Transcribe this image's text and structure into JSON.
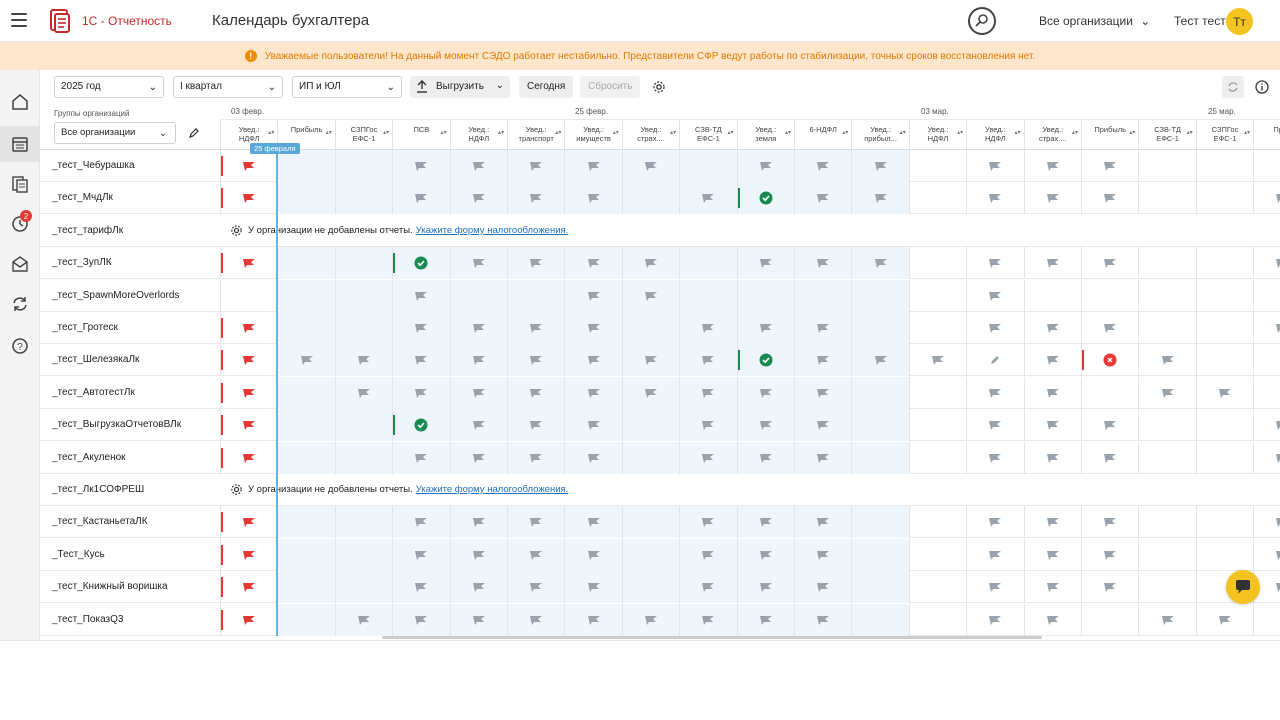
{
  "header": {
    "brand": "1С - Отчетность",
    "title": "Календарь бухгалтера",
    "org_select": "Все организации",
    "user_name": "Тест тест",
    "avatar_initials": "Тт"
  },
  "banner": {
    "text": "Уважаемые пользователи! На данный момент СЭДО работает нестабильно. Представители СФР ведут работы по стабилизации, точных сроков восстановления нет.",
    "color": "#e07b00"
  },
  "rail": {
    "icons": [
      "home-icon",
      "calendar-icon",
      "reports-icon",
      "requests-icon",
      "mail-icon",
      "sync-icon",
      "help-icon"
    ],
    "badge": "2"
  },
  "toolbar": {
    "year": "2025 год",
    "quarter": "I квартал",
    "entity": "ИП и ЮЛ",
    "export": "Выгрузить",
    "today": "Сегодня",
    "reset": "Сбросить"
  },
  "grid": {
    "groups_label": "Группы организаций",
    "groups_value": "Все организации",
    "dates": [
      "03 февр.",
      "25 февр.",
      "03 мар.",
      "25 мар."
    ],
    "today_tag": "25 февраля",
    "columns": [
      {
        "l1": "Увед.:",
        "l2": "НДФЛ"
      },
      {
        "l1": "Прибыль",
        "l2": ""
      },
      {
        "l1": "СЗПГос",
        "l2": "ЕФС-1"
      },
      {
        "l1": "ПСВ",
        "l2": ""
      },
      {
        "l1": "Увед.:",
        "l2": "НДФЛ"
      },
      {
        "l1": "Увед.:",
        "l2": "транспорт"
      },
      {
        "l1": "Увед.:",
        "l2": "имуществ"
      },
      {
        "l1": "Увед.:",
        "l2": "страх...."
      },
      {
        "l1": "СЗВ-ТД",
        "l2": "ЕФС-1"
      },
      {
        "l1": "Увед.:",
        "l2": "земля"
      },
      {
        "l1": "6-НДФЛ",
        "l2": ""
      },
      {
        "l1": "Увед.:",
        "l2": "прибыл..."
      },
      {
        "l1": "Увед.:",
        "l2": "НДФЛ"
      },
      {
        "l1": "Увед.:",
        "l2": "НДФЛ"
      },
      {
        "l1": "Увед.:",
        "l2": "страх...."
      },
      {
        "l1": "Прибыль",
        "l2": ""
      },
      {
        "l1": "СЗВ-ТД",
        "l2": "ЕФС-1"
      },
      {
        "l1": "СЗПГос",
        "l2": "ЕФС-1"
      },
      {
        "l1": "Приб",
        "l2": ""
      }
    ],
    "no_reports_text": "У организации не добавлены отчеты.",
    "no_reports_link": "Укажите форму налогообложения.",
    "rows": [
      {
        "name": "_тест_Чебурашка"
      },
      {
        "name": "_тест_МчдЛк"
      },
      {
        "name": "_тест_тарифЛк"
      },
      {
        "name": "_тест_ЗупЛК"
      },
      {
        "name": "_тест_SpawnMoreOverlords"
      },
      {
        "name": "_тест_Гротеск"
      },
      {
        "name": "_тест_ШелезякаЛк"
      },
      {
        "name": "_тест_АвтотестЛк"
      },
      {
        "name": "_тест_ВыгрузкаОтчетовВЛк"
      },
      {
        "name": "_тест_Акуленок"
      },
      {
        "name": "_тест_Лк1СОФРЕШ"
      },
      {
        "name": "_тест_КастаньетаЛК"
      },
      {
        "name": "_Тест_Кусь"
      },
      {
        "name": "_тест_Книжный воришка"
      },
      {
        "name": "_тест_ПоказQ3"
      }
    ]
  }
}
